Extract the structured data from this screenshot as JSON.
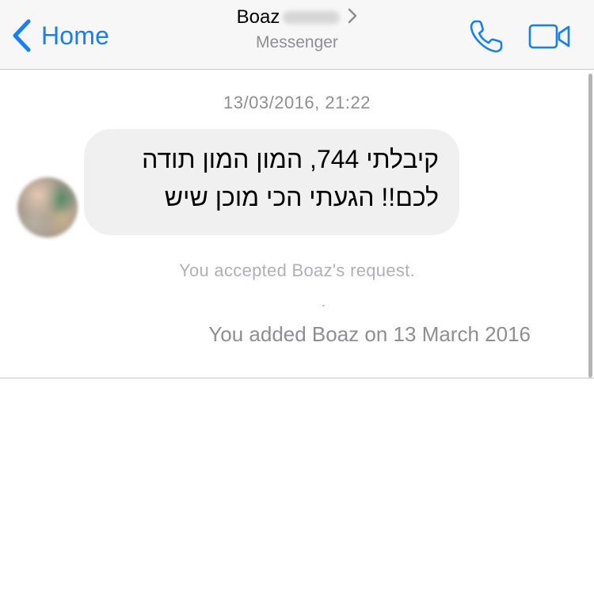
{
  "navbar": {
    "back_label": "Home",
    "title": "Boaz",
    "subtitle": "Messenger",
    "call_icon": "phone-icon",
    "video_icon": "video-camera-icon",
    "accent_color": "#147efb"
  },
  "thread": {
    "timestamp": "13/03/2016, 21:22",
    "messages": [
      {
        "sender": "Boaz",
        "lines": [
          "קיבלתי 744, המון המון תודה",
          "לכם!! הגעתי הכי מוכן שיש"
        ]
      }
    ],
    "system_notice": "You accepted Boaz's request.",
    "added_info": "You added Boaz on 13 March 2016"
  }
}
